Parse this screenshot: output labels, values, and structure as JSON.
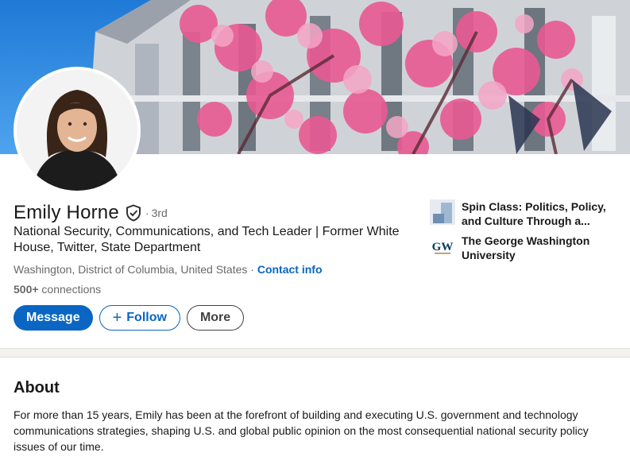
{
  "profile": {
    "name": "Emily Horne",
    "degree_dot": "·",
    "degree": "3rd",
    "headline": "National Security, Communications, and Tech Leader | Former White House, Twitter, State Department",
    "location": "Washington, District of Columbia, United States",
    "location_separator": " · ",
    "contact_info": "Contact info",
    "connections_count": "500+",
    "connections_label": " connections"
  },
  "actions": {
    "message": "Message",
    "follow_icon": "+",
    "follow": "Follow",
    "more": "More"
  },
  "sidebar": {
    "items": [
      {
        "label": "Spin Class: Politics, Policy, and Culture Through a...",
        "icon": "company-logo-icon"
      },
      {
        "label": "The George Washington University",
        "icon": "gw-logo-icon",
        "logo_text": "GW"
      }
    ]
  },
  "about": {
    "title": "About",
    "text": "For more than 15 years, Emily has been at the forefront of building and executing U.S. government and technology communications strategies, shaping U.S. and global public opinion on the most consequential national security policy issues of our time."
  },
  "colors": {
    "accent": "#0a66c2",
    "page_bg": "#f4f2ee",
    "card_bg": "#ffffff"
  }
}
